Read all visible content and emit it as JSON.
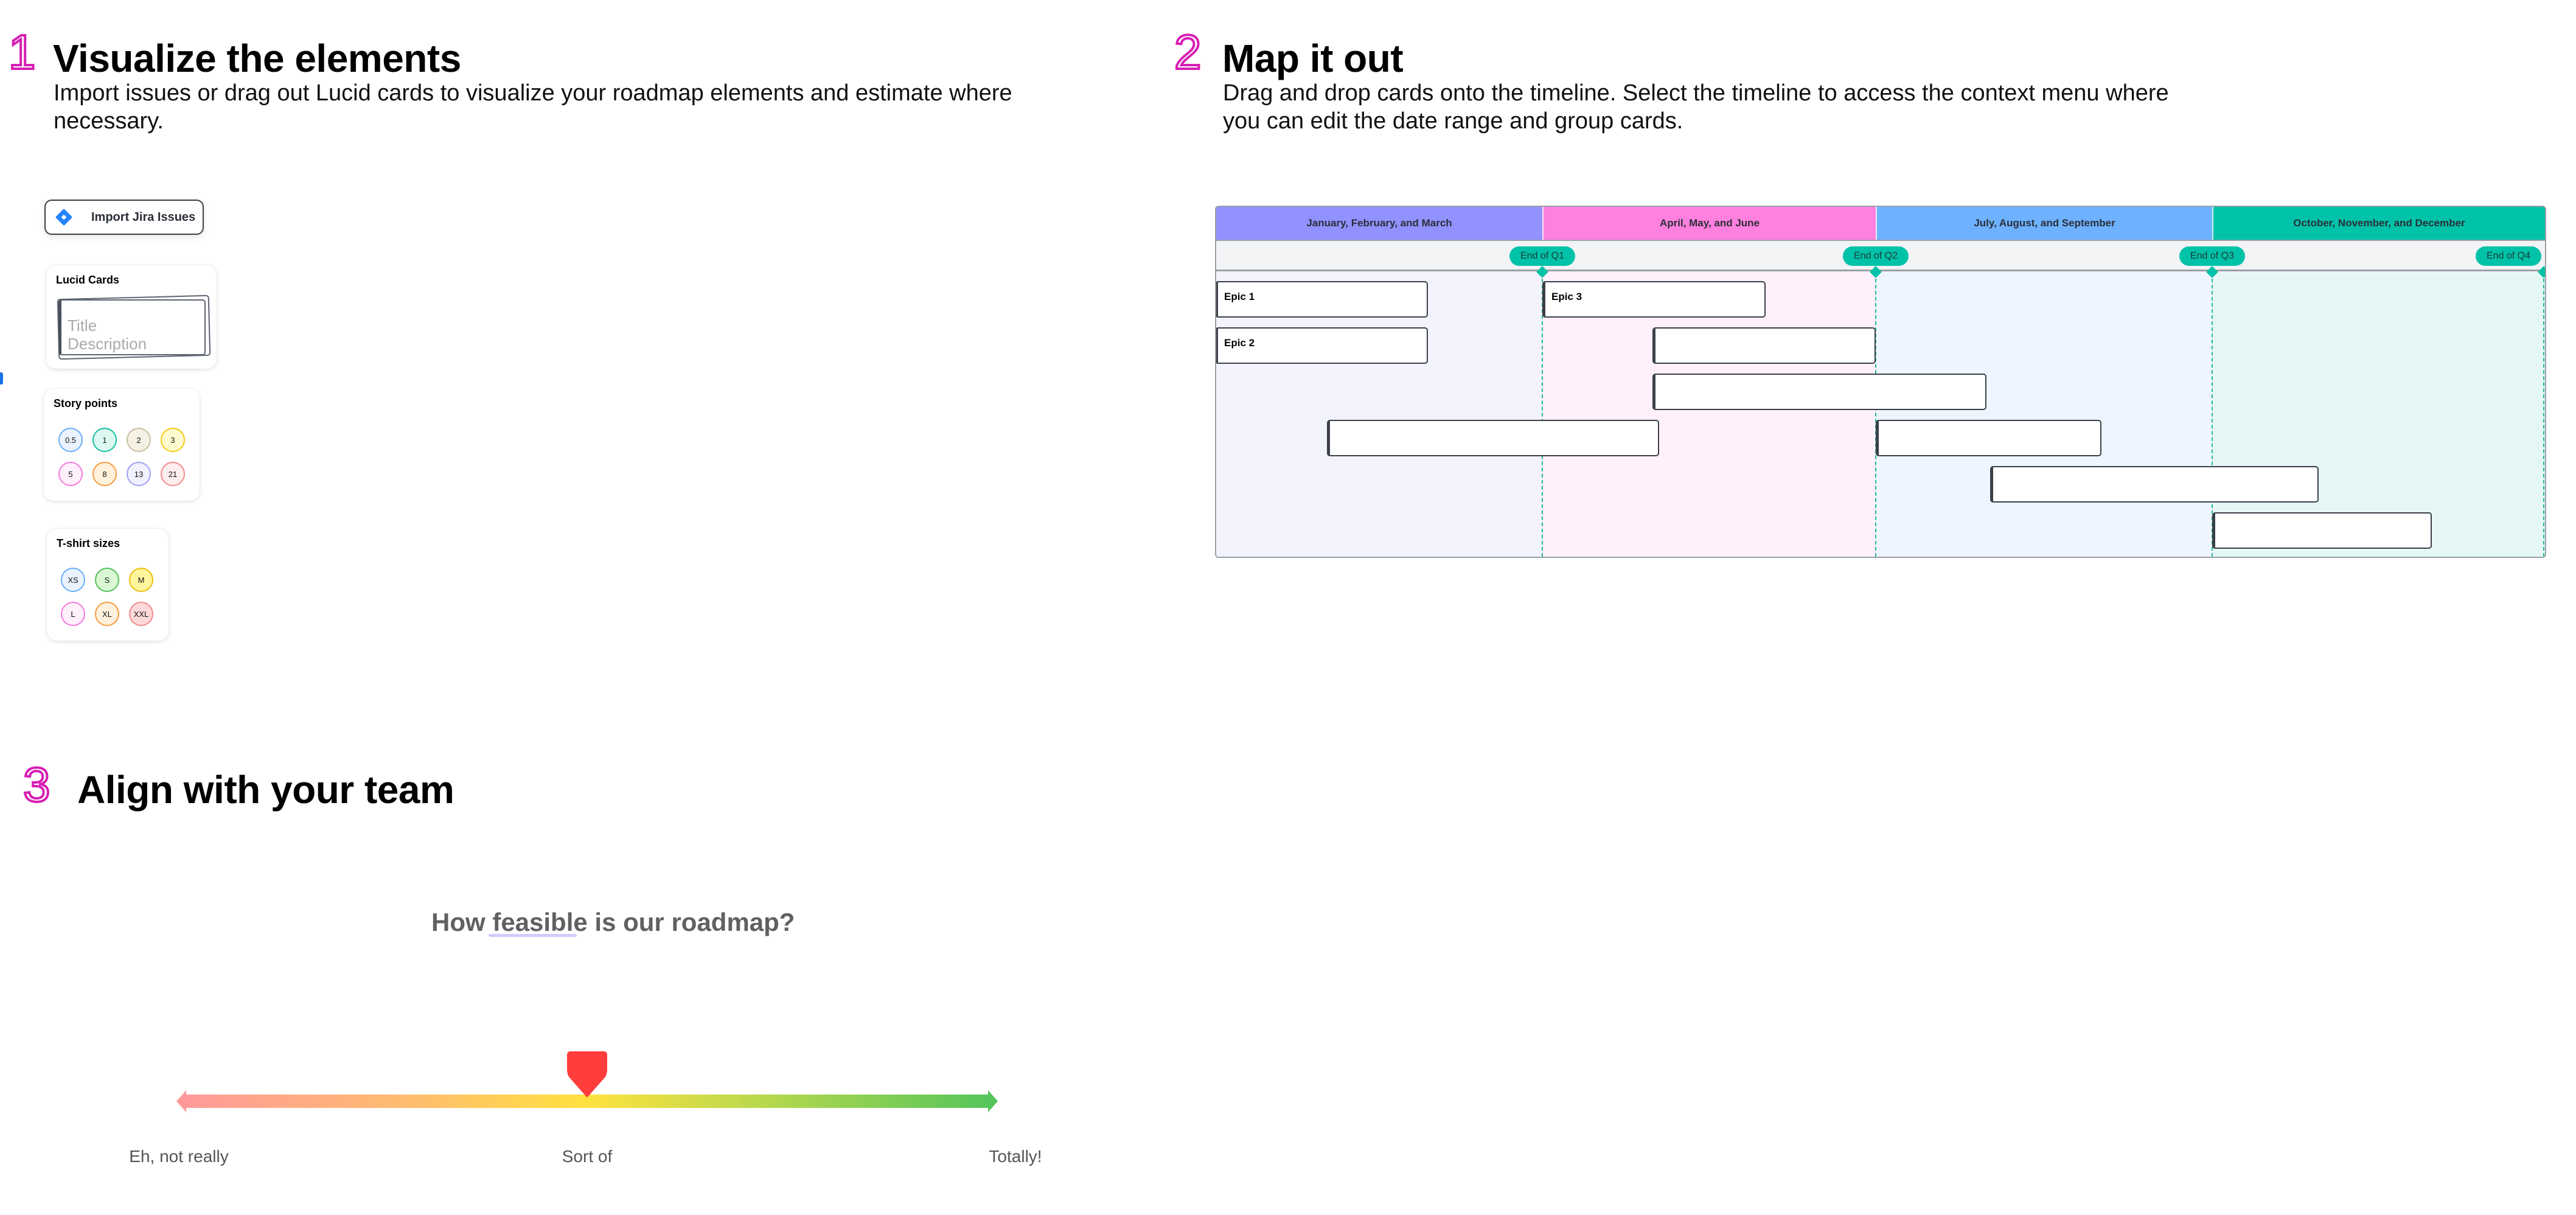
{
  "sections": {
    "visualize": {
      "number": "1",
      "title": "Visualize the elements",
      "subtitle_line1": "Import issues or drag out Lucid cards to visualize your roadmap elements and estimate where",
      "subtitle_line2": "necessary."
    },
    "map": {
      "number": "2",
      "title": "Map it out",
      "subtitle_line1": "Drag and drop cards onto the timeline. Select the timeline to access the context menu where",
      "subtitle_line2": "you can edit the date range and group cards."
    },
    "align": {
      "number": "3",
      "title": "Align with your team"
    }
  },
  "jira_button": {
    "label": "Import Jira Issues",
    "icon": "jira-icon"
  },
  "lucid_cards": {
    "title": "Lucid Cards",
    "card_title_placeholder": "Title",
    "card_description_placeholder": "Description"
  },
  "story_points": {
    "title": "Story points",
    "chips": [
      {
        "label": "0.5",
        "border": "#6aaef7",
        "fill": "#eaf3ff"
      },
      {
        "label": "1",
        "border": "#12bfa3",
        "fill": "#dcf8f1"
      },
      {
        "label": "2",
        "border": "#c9bea0",
        "fill": "#f5f1e4"
      },
      {
        "label": "3",
        "border": "#f5c90f",
        "fill": "#fffbd0"
      },
      {
        "label": "5",
        "border": "#f57be0",
        "fill": "#fff0fc"
      },
      {
        "label": "8",
        "border": "#f59a3f",
        "fill": "#fff1dc"
      },
      {
        "label": "13",
        "border": "#a0a0f5",
        "fill": "#f1f1ff"
      },
      {
        "label": "21",
        "border": "#f28c8c",
        "fill": "#ffeeee"
      }
    ]
  },
  "tshirt_sizes": {
    "title": "T-shirt sizes",
    "chips": [
      {
        "label": "XS",
        "border": "#6aaef7",
        "fill": "#eaf3ff"
      },
      {
        "label": "S",
        "border": "#55c05c",
        "fill": "#dbf8d5"
      },
      {
        "label": "M",
        "border": "#eebc10",
        "fill": "#fff59c"
      },
      {
        "label": "L",
        "border": "#f57be0",
        "fill": "#fff0fc"
      },
      {
        "label": "XL",
        "border": "#f59a3f",
        "fill": "#fff1dc"
      },
      {
        "label": "XXL",
        "border": "#f28c8c",
        "fill": "#ffd9d9"
      }
    ]
  },
  "timeline": {
    "quarters": [
      {
        "label": "January, February, and March",
        "header_color": "#9191ff",
        "band_color": "#f3f3fd"
      },
      {
        "label": "April, May, and June",
        "header_color": "#ff80df",
        "band_color": "#fff0fb"
      },
      {
        "label": "July, August, and September",
        "header_color": "#6db1ff",
        "band_color": "#eef5fe"
      },
      {
        "label": "October, November, and December",
        "header_color": "#00c2a8",
        "band_color": "#e4f7f4"
      }
    ],
    "milestones": [
      {
        "label": "End of Q1",
        "quarter_end": 1
      },
      {
        "label": "End of Q2",
        "quarter_end": 2
      },
      {
        "label": "End of Q3",
        "quarter_end": 3
      },
      {
        "label": "End of Q4",
        "quarter_end": 4
      }
    ],
    "cards": [
      {
        "label": "Epic 1",
        "row": 0,
        "start_q": 0.0,
        "end_q": 0.65
      },
      {
        "label": "Epic 2",
        "row": 1,
        "start_q": 0.0,
        "end_q": 0.65
      },
      {
        "label": "Epic 3",
        "row": 0,
        "start_q": 1.0,
        "end_q": 1.67
      },
      {
        "label": "",
        "row": 1,
        "start_q": 1.33,
        "end_q": 2.0
      },
      {
        "label": "",
        "row": 2,
        "start_q": 1.33,
        "end_q": 2.33
      },
      {
        "label": "",
        "row": 3,
        "start_q": 0.34,
        "end_q": 1.35
      },
      {
        "label": "",
        "row": 3,
        "start_q": 2.0,
        "end_q": 2.67
      },
      {
        "label": "",
        "row": 4,
        "start_q": 2.34,
        "end_q": 3.32
      },
      {
        "label": "",
        "row": 5,
        "start_q": 3.0,
        "end_q": 3.66
      }
    ]
  },
  "feasibility": {
    "question_prefix": "How ",
    "question_emphasis": "feasible",
    "question_suffix": " is our roadmap?",
    "labels": [
      "Eh, not really",
      "Sort of",
      "Totally!"
    ],
    "marker_value": 0.5,
    "marker_color": "#ff3d3d"
  }
}
